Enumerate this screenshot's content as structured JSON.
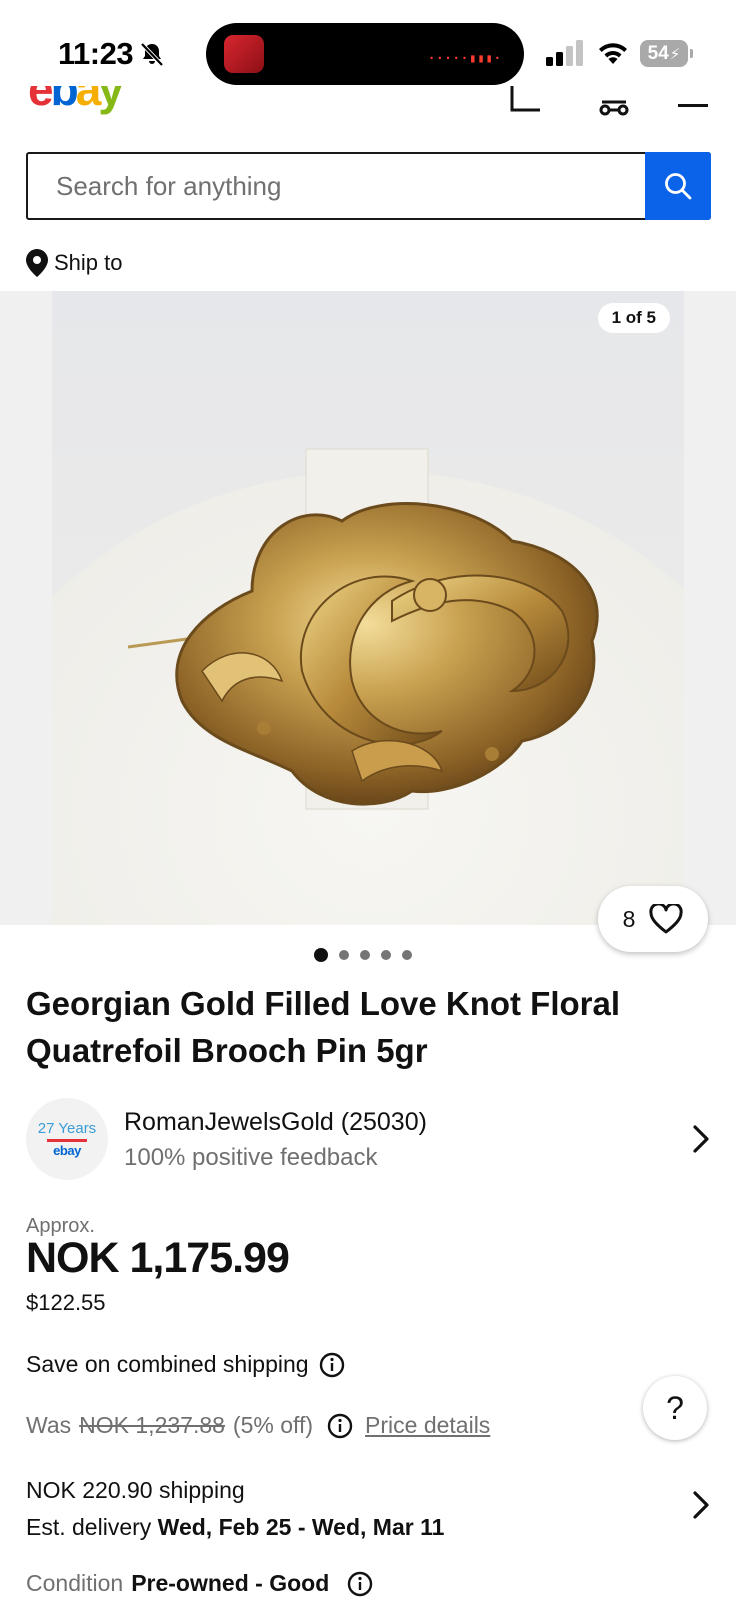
{
  "status_bar": {
    "time": "11:23",
    "battery": "54",
    "icons": [
      "bell-slash-icon",
      "signal-icon",
      "wifi-icon",
      "battery-icon"
    ]
  },
  "header": {
    "logo_letters": [
      "e",
      "b",
      "a",
      "y"
    ],
    "icons": [
      "cart-icon",
      "garage-icon",
      "menu-icon"
    ]
  },
  "search": {
    "placeholder": "Search for anything",
    "button_icon": "search-icon"
  },
  "ship_to": {
    "label": "Ship to",
    "icon": "location-pin-icon"
  },
  "gallery": {
    "counter": "1 of 5",
    "watch_count": "8",
    "total_images": 5,
    "active_index": 1
  },
  "listing": {
    "title": "Georgian Gold Filled Love Knot Floral Quatrefoil Brooch Pin 5gr"
  },
  "seller": {
    "badge_years": "27 Years",
    "badge_brand": "ebay",
    "name": "RomanJewelsGold (25030)",
    "feedback": "100% positive feedback"
  },
  "price": {
    "approx_label": "Approx.",
    "amount": "NOK 1,175.99",
    "usd": "$122.55",
    "combined_shipping": "Save on combined shipping",
    "was_label": "Was",
    "was_amount": "NOK 1,237.88",
    "discount": "(5% off)",
    "price_details": "Price details"
  },
  "shipping": {
    "cost": "NOK 220.90 shipping",
    "delivery_label": "Est. delivery",
    "delivery_dates": "Wed, Feb 25 - Wed, Mar 11"
  },
  "condition": {
    "label": "Condition",
    "value": "Pre-owned - Good"
  },
  "help": {
    "label": "?"
  },
  "colors": {
    "search_button": "#0b63ea",
    "text_primary": "#111820",
    "text_secondary": "#707070"
  }
}
